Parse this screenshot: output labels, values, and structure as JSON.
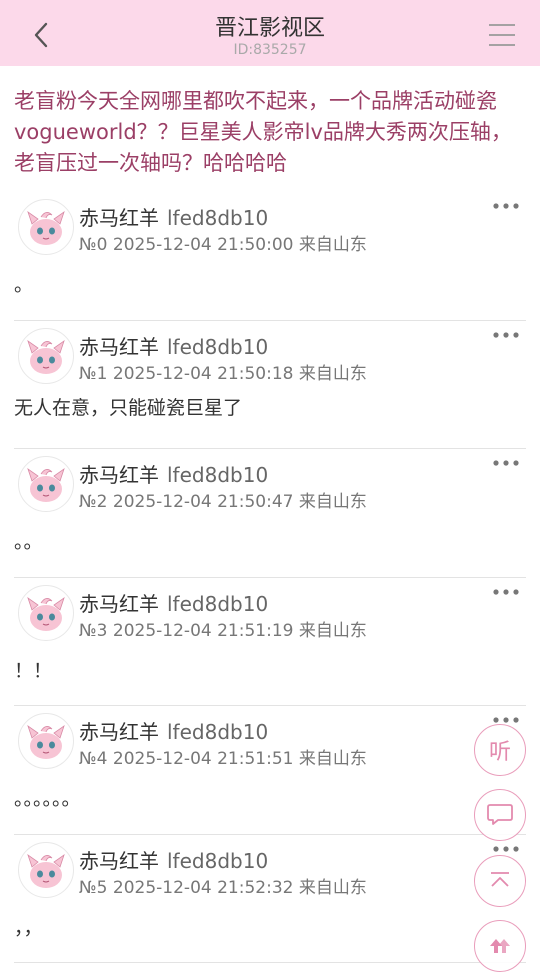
{
  "header": {
    "title": "晋江影视区",
    "id_label": "ID:835257",
    "colors": {
      "background": "#fcd9ea",
      "accent": "#9b3f66",
      "float_button": "#e38aae"
    }
  },
  "thread": {
    "title": "老盲粉今天全网哪里都吹不起来，一个品牌活动碰瓷vogueworld？？巨星美人影帝lv品牌大秀两次压轴，老盲压过一次轴吗？哈哈哈哈"
  },
  "posts": [
    {
      "author": "赤马红羊",
      "author_id": "lfed8db10",
      "meta": "№0 2025-12-04 21:50:00 来自山东",
      "content": "。"
    },
    {
      "author": "赤马红羊",
      "author_id": "lfed8db10",
      "meta": "№1 2025-12-04 21:50:18 来自山东",
      "content": "无人在意，只能碰瓷巨星了"
    },
    {
      "author": "赤马红羊",
      "author_id": "lfed8db10",
      "meta": "№2 2025-12-04 21:50:47 来自山东",
      "content": "。。"
    },
    {
      "author": "赤马红羊",
      "author_id": "lfed8db10",
      "meta": "№3 2025-12-04 21:51:19 来自山东",
      "content": "！！"
    },
    {
      "author": "赤马红羊",
      "author_id": "lfed8db10",
      "meta": "№4 2025-12-04 21:51:51 来自山东",
      "content": "。。。。。。"
    },
    {
      "author": "赤马红羊",
      "author_id": "lfed8db10",
      "meta": "№5 2025-12-04 21:52:32 来自山东",
      "content": "，，"
    }
  ],
  "float_buttons": {
    "listen_label": "听",
    "icons": [
      "chat-icon",
      "scroll-top-icon",
      "refresh-icon"
    ]
  }
}
